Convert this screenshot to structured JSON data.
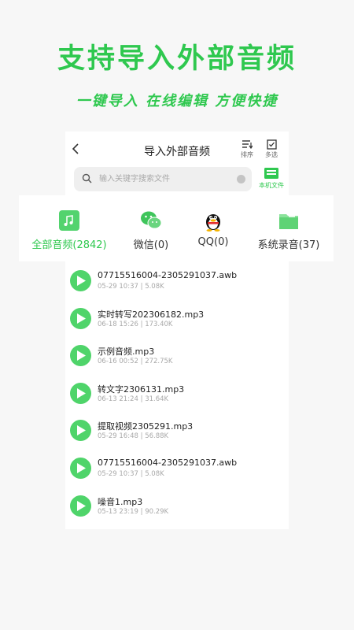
{
  "promo": {
    "title": "支持导入外部音频",
    "subtitle": "一键导入 在线编辑 方便快捷"
  },
  "header": {
    "title": "导入外部音频",
    "sort_label": "排序",
    "multiselect_label": "多选"
  },
  "search": {
    "placeholder": "输入关键字搜索文件",
    "value": ""
  },
  "local_file": {
    "label": "本机文件"
  },
  "tabs": [
    {
      "label": "全部音频(2842)",
      "icon": "music-note-icon",
      "active": true
    },
    {
      "label": "微信(0)",
      "icon": "wechat-icon",
      "active": false
    },
    {
      "label": "QQ(0)",
      "icon": "qq-penguin-icon",
      "active": false
    },
    {
      "label": "系统录音(37)",
      "icon": "folder-icon",
      "active": false
    }
  ],
  "files": [
    {
      "name": "07715516004-2305291037.awb",
      "date": "05-29 10:37",
      "size": "5.08K"
    },
    {
      "name": "实时转写202306182.mp3",
      "date": "06-18 15:26",
      "size": "173.40K"
    },
    {
      "name": "示例音频.mp3",
      "date": "06-16 00:52",
      "size": "272.75K"
    },
    {
      "name": "转文字2306131.mp3",
      "date": "06-13 21:24",
      "size": "31.64K"
    },
    {
      "name": "提取视频2305291.mp3",
      "date": "05-29 16:48",
      "size": "56.88K"
    },
    {
      "name": "07715516004-2305291037.awb",
      "date": "05-29 10:37",
      "size": "5.08K"
    },
    {
      "name": "噪音1.mp3",
      "date": "05-13 23:19",
      "size": "90.29K"
    }
  ],
  "colors": {
    "accent": "#2fc84f",
    "play": "#4fd46a",
    "meta_text": "#a8a8a8"
  }
}
